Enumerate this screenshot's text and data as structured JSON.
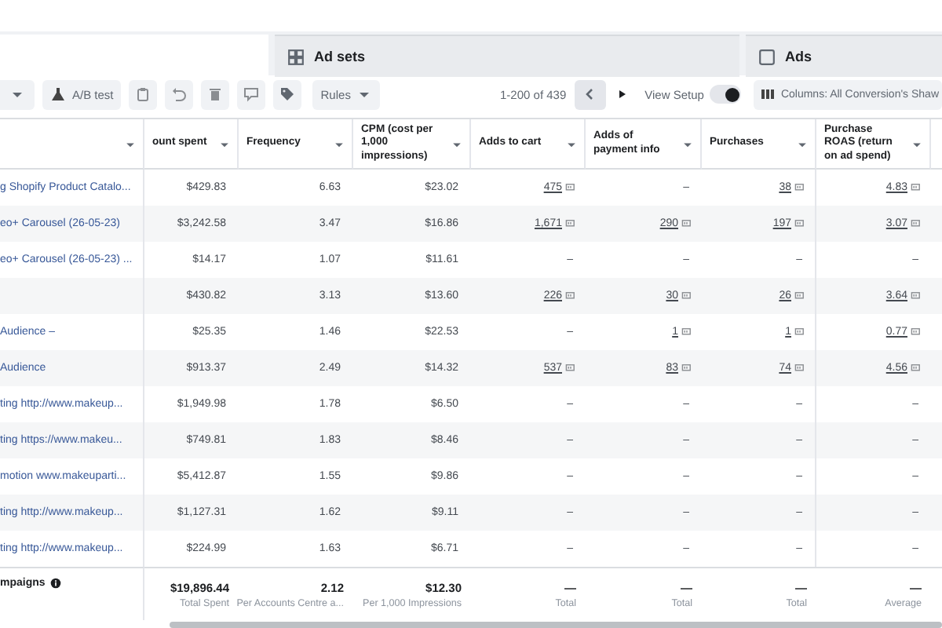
{
  "tabs": [
    {
      "selected": true
    },
    {
      "label": "Ad sets",
      "selected": false
    },
    {
      "label": "Ads",
      "selected": false
    }
  ],
  "toolbar": {
    "left": [
      {
        "kind": "caret"
      },
      {
        "kind": "flask",
        "label": "A/B test"
      },
      {
        "kind": "copy"
      },
      {
        "kind": "undo"
      },
      {
        "kind": "trash"
      },
      {
        "kind": "comment"
      },
      {
        "kind": "tag"
      },
      {
        "kind": "menu",
        "label": "Rules"
      }
    ],
    "range": "1-200 of 439",
    "view_setup": {
      "label": "View Setup",
      "on": true
    },
    "columns_button": "Columns: All Conversion's Shaw"
  },
  "table": {
    "columns": [
      {},
      {
        "label": "ount spent"
      },
      {
        "label": "Frequency"
      },
      {
        "label": "CPM (cost per 1,000 impressions)"
      },
      {
        "label": "Adds to cart"
      },
      {
        "label": "Adds of payment info"
      },
      {
        "label": "Purchases"
      },
      {
        "label": "Purchase ROAS (return on ad spend)"
      }
    ],
    "rows": [
      {
        "name": "g Shopify Product Catalo...",
        "cells": [
          "$429.83",
          "6.63",
          "$23.02",
          {
            "value": "475",
            "linked": true
          },
          "–",
          {
            "value": "38",
            "linked": true
          },
          {
            "value": "4.83",
            "linked": true
          }
        ]
      },
      {
        "name": "eo+ Carousel (26-05-23)",
        "cells": [
          "$3,242.58",
          "3.47",
          "$16.86",
          {
            "value": "1,671",
            "linked": true
          },
          {
            "value": "290",
            "linked": true
          },
          {
            "value": "197",
            "linked": true
          },
          {
            "value": "3.07",
            "linked": true
          }
        ]
      },
      {
        "name": "eo+ Carousel (26-05-23) ...",
        "cells": [
          "$14.17",
          "1.07",
          "$11.61",
          "–",
          "–",
          "–",
          "–"
        ]
      },
      {
        "name": "",
        "cells": [
          "$430.82",
          "3.13",
          "$13.60",
          {
            "value": "226",
            "linked": true
          },
          {
            "value": "30",
            "linked": true
          },
          {
            "value": "26",
            "linked": true
          },
          {
            "value": "3.64",
            "linked": true
          }
        ]
      },
      {
        "name": "Audience –",
        "cells": [
          "$25.35",
          "1.46",
          "$22.53",
          "–",
          {
            "value": "1",
            "linked": true
          },
          {
            "value": "1",
            "linked": true
          },
          {
            "value": "0.77",
            "linked": true
          }
        ]
      },
      {
        "name": "Audience",
        "cells": [
          "$913.37",
          "2.49",
          "$14.32",
          {
            "value": "537",
            "linked": true
          },
          {
            "value": "83",
            "linked": true
          },
          {
            "value": "74",
            "linked": true
          },
          {
            "value": "4.56",
            "linked": true
          }
        ]
      },
      {
        "name": "ting http://www.makeup...",
        "cells": [
          "$1,949.98",
          "1.78",
          "$6.50",
          "–",
          "–",
          "–",
          "–"
        ]
      },
      {
        "name": "ting https://www.makeu...",
        "cells": [
          "$749.81",
          "1.83",
          "$8.46",
          "–",
          "–",
          "–",
          "–"
        ]
      },
      {
        "name": "motion www.makeuparti...",
        "cells": [
          "$5,412.87",
          "1.55",
          "$9.86",
          "–",
          "–",
          "–",
          "–"
        ]
      },
      {
        "name": "ting http://www.makeup...",
        "cells": [
          "$1,127.31",
          "1.62",
          "$9.11",
          "–",
          "–",
          "–",
          "–"
        ]
      },
      {
        "name": "ting http://www.makeup...",
        "cells": [
          "$224.99",
          "1.63",
          "$6.71",
          "–",
          "–",
          "–",
          "–"
        ]
      }
    ],
    "footer": {
      "label": "mpaigns",
      "cells": [
        {
          "value": "$19,896.44",
          "note": "Total Spent"
        },
        {
          "value": "2.12",
          "note": "Per Accounts Centre a..."
        },
        {
          "value": "$12.30",
          "note": "Per 1,000 Impressions"
        },
        {
          "value": "—",
          "note": "Total"
        },
        {
          "value": "—",
          "note": "Total"
        },
        {
          "value": "—",
          "note": "Total"
        },
        {
          "value": "—",
          "note": "Average"
        }
      ]
    }
  }
}
